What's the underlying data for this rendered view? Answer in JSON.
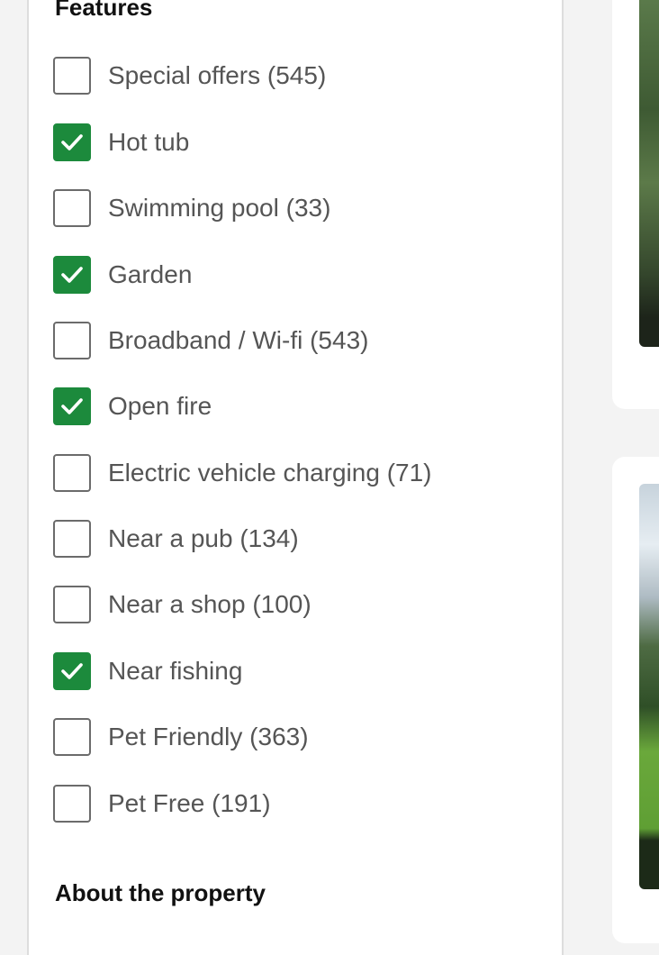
{
  "filters": {
    "features_title": "Features",
    "items": [
      {
        "label": "Special offers (545)",
        "checked": false
      },
      {
        "label": "Hot tub",
        "checked": true
      },
      {
        "label": "Swimming pool (33)",
        "checked": false
      },
      {
        "label": "Garden",
        "checked": true
      },
      {
        "label": "Broadband / Wi-fi (543)",
        "checked": false
      },
      {
        "label": "Open fire",
        "checked": true
      },
      {
        "label": "Electric vehicle charging (71)",
        "checked": false
      },
      {
        "label": "Near a pub (134)",
        "checked": false
      },
      {
        "label": "Near a shop (100)",
        "checked": false
      },
      {
        "label": "Near fishing",
        "checked": true
      },
      {
        "label": "Pet Friendly (363)",
        "checked": false
      },
      {
        "label": "Pet Free (191)",
        "checked": false
      }
    ],
    "about_title": "About the property"
  },
  "icons": {
    "checkmark": "checkmark-icon"
  },
  "colors": {
    "checked": "#1c8a3c",
    "label_text": "#555555",
    "heading_text": "#111111"
  }
}
